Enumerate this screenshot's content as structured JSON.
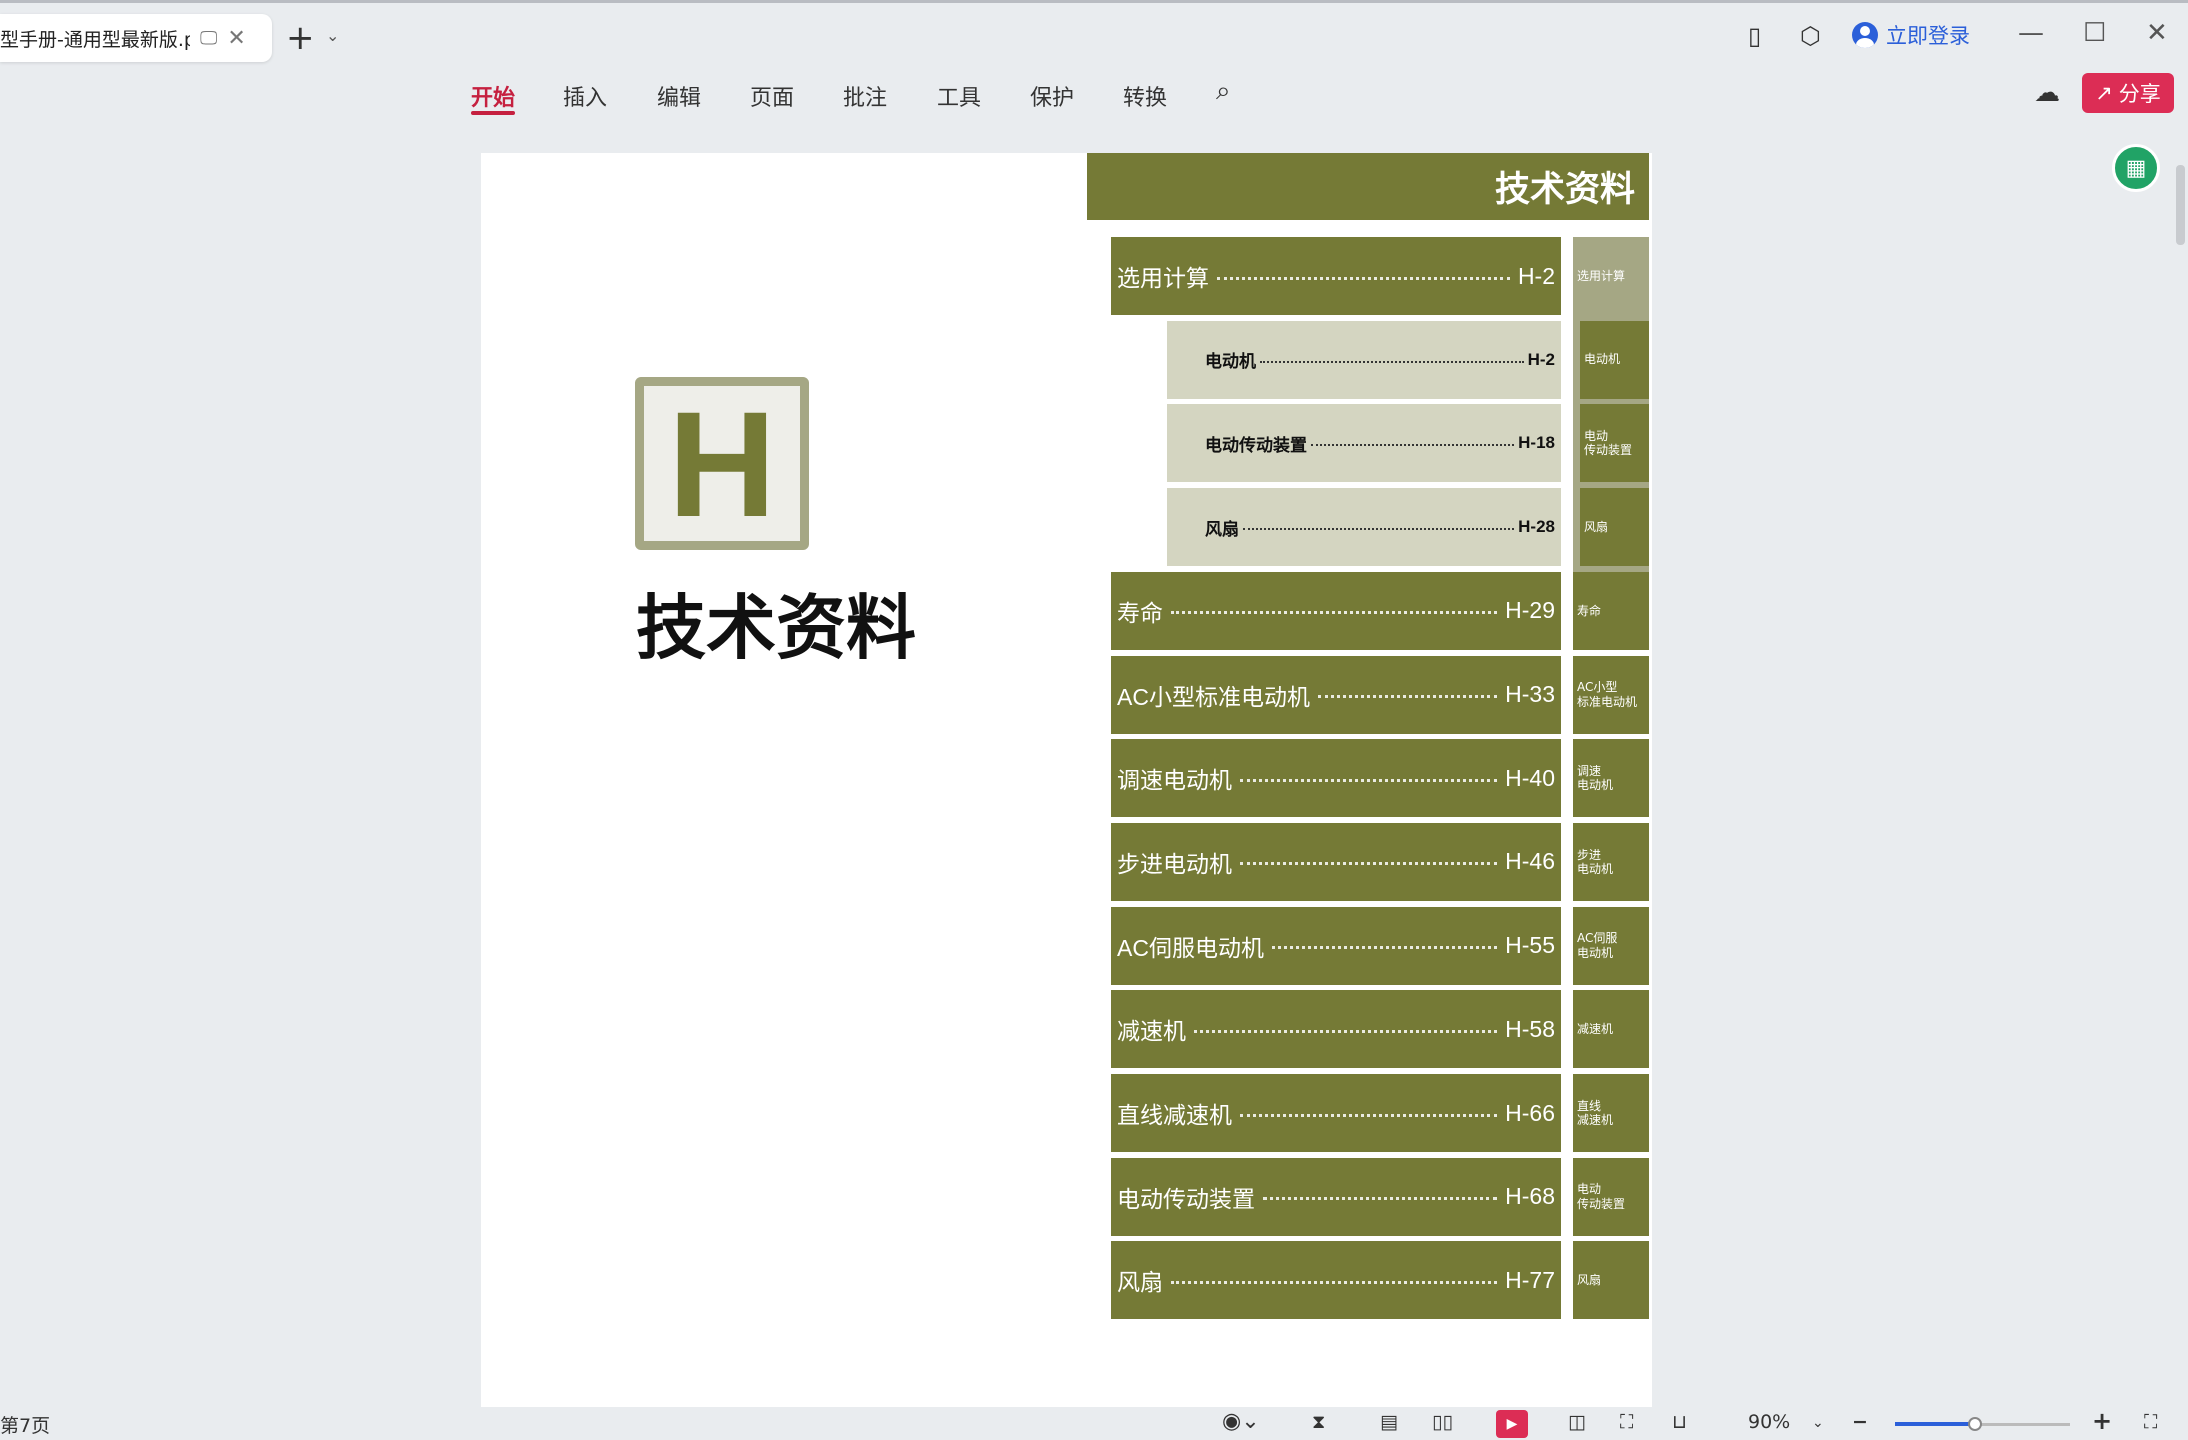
{
  "tab": {
    "title": "型手册-通用型最新版.pdf",
    "monitor_icon": "monitor-icon",
    "close_icon": "close-icon"
  },
  "ribbon": {
    "tabs": [
      "开始",
      "插入",
      "编辑",
      "页面",
      "批注",
      "工具",
      "保护",
      "转换"
    ],
    "active": "开始"
  },
  "titlebar": {
    "login": "立即登录"
  },
  "toolbar": {
    "share": "分享"
  },
  "document": {
    "header": "技术资料",
    "section_letter": "H",
    "section_title": "技术资料",
    "toc": [
      {
        "label": "选用计算",
        "page": "H-2",
        "side": "选用计算",
        "level": 1
      },
      {
        "label": "电动机",
        "page": "H-2",
        "side": "电动机",
        "level": 2
      },
      {
        "label": "电动传动装置",
        "page": "H-18",
        "side": "电动\n传动装置",
        "level": 2
      },
      {
        "label": "风扇",
        "page": "H-28",
        "side": "风扇",
        "level": 2
      },
      {
        "label": "寿命",
        "page": "H-29",
        "side": "寿命",
        "level": 1
      },
      {
        "label": "AC小型标准电动机",
        "page": "H-33",
        "side": "AC小型\n标准电动机",
        "level": 1
      },
      {
        "label": "调速电动机",
        "page": "H-40",
        "side": "调速\n电动机",
        "level": 1
      },
      {
        "label": "步进电动机",
        "page": "H-46",
        "side": "步进\n电动机",
        "level": 1
      },
      {
        "label": "AC伺服电动机",
        "page": "H-55",
        "side": "AC伺服\n电动机",
        "level": 1
      },
      {
        "label": "减速机",
        "page": "H-58",
        "side": "减速机",
        "level": 1
      },
      {
        "label": "直线减速机",
        "page": "H-66",
        "side": "直线\n减速机",
        "level": 1
      },
      {
        "label": "电动传动装置",
        "page": "H-68",
        "side": "电动\n传动装置",
        "level": 1
      },
      {
        "label": "风扇",
        "page": "H-77",
        "side": "风扇",
        "level": 1
      }
    ],
    "colors": {
      "olive": "#757a36",
      "light_olive": "#a5a784",
      "sub_bg": "#d4d5c1"
    }
  },
  "status": {
    "page": "第7页",
    "zoom": "90%",
    "zoom_percent": 90
  }
}
